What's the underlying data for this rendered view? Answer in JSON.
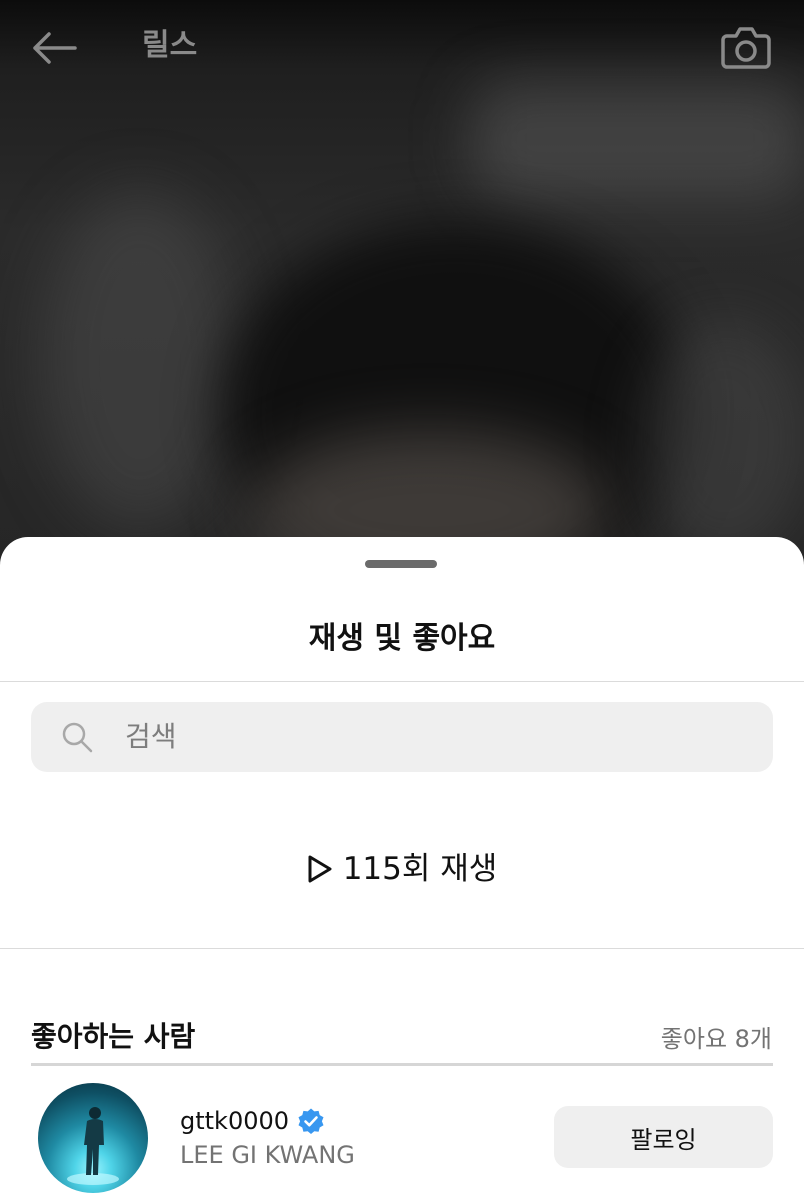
{
  "topbar": {
    "title": "릴스",
    "back_icon": "arrow-left-icon",
    "camera_icon": "camera-icon"
  },
  "sheet": {
    "title": "재생 및 좋아요",
    "search": {
      "placeholder": "검색",
      "icon": "search-icon"
    },
    "plays": {
      "icon": "play-icon",
      "text": "115회 재생"
    },
    "likers": {
      "title": "좋아하는 사람",
      "count_text": "좋아요 8개",
      "items": [
        {
          "username": "gttk0000",
          "verified": true,
          "full_name": "LEE GI KWANG",
          "follow_label": "팔로잉"
        }
      ]
    }
  },
  "colors": {
    "verified_badge": "#3897f0",
    "sheet_background": "#ffffff",
    "search_background": "#efefef",
    "secondary_text": "#737373"
  }
}
